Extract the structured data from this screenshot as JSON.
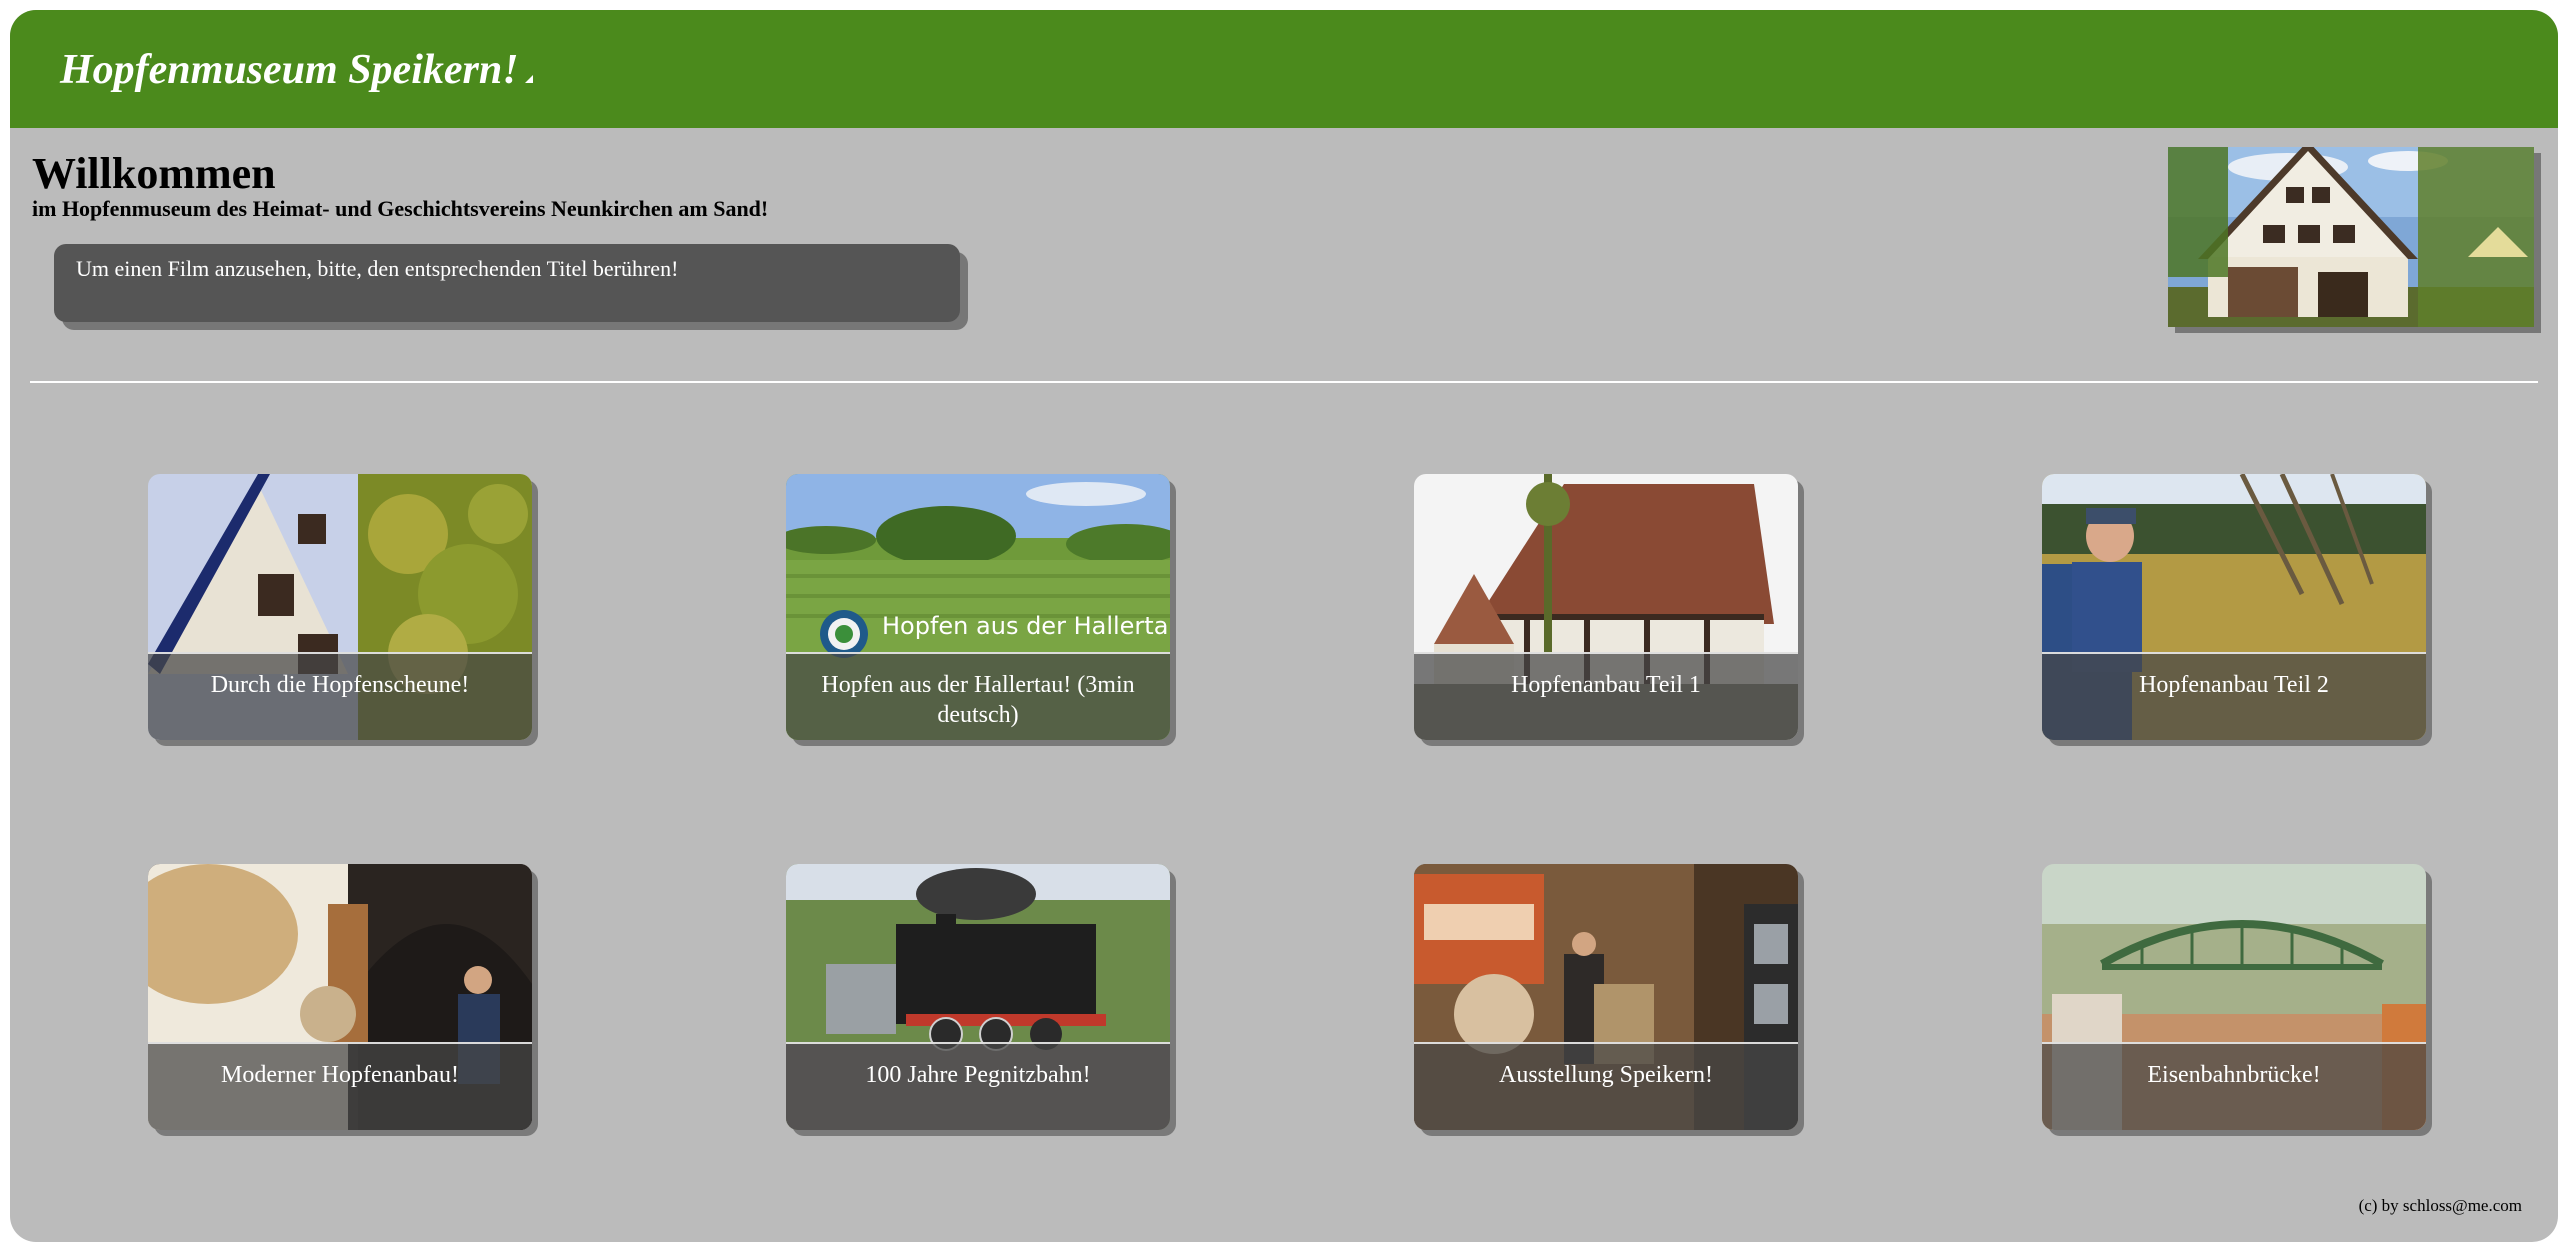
{
  "header": {
    "title": "Hopfenmuseum Speikern!"
  },
  "welcome": {
    "title": "Willkommen",
    "subtitle": "im Hopfenmuseum des Heimat- und Geschichtsvereins Neunkirchen am Sand!",
    "hint": "Um einen Film anzusehen, bitte, den entsprechenden Titel berühren!"
  },
  "films": [
    {
      "title": "Durch die Hopfenscheune!",
      "thumbnail_icon": "hop-barn-gable-thumbnail"
    },
    {
      "title": "Hopfen aus der Hallertau! (3min deutsch)",
      "thumbnail_icon": "hallertau-field-thumbnail",
      "thumbnail_text": "Hopfen aus der Hallertau"
    },
    {
      "title": "Hopfenanbau Teil 1",
      "thumbnail_icon": "half-timbered-house-thumbnail"
    },
    {
      "title": "Hopfenanbau Teil 2",
      "thumbnail_icon": "farmer-hop-field-thumbnail"
    },
    {
      "title": "Moderner Hopfenanbau!",
      "thumbnail_icon": "hop-sacks-thumbnail"
    },
    {
      "title": "100 Jahre Pegnitzbahn!",
      "thumbnail_icon": "steam-locomotive-thumbnail"
    },
    {
      "title": "Ausstellung Speikern!",
      "thumbnail_icon": "railway-exhibition-thumbnail"
    },
    {
      "title": "Eisenbahnbrücke!",
      "thumbnail_icon": "railway-bridge-thumbnail"
    }
  ],
  "footer": {
    "copyright": "(c) by schloss@me.com"
  },
  "colors": {
    "header_green": "#4b8a1c",
    "page_gray": "#bbbbbb",
    "hint_box": "#555555"
  }
}
